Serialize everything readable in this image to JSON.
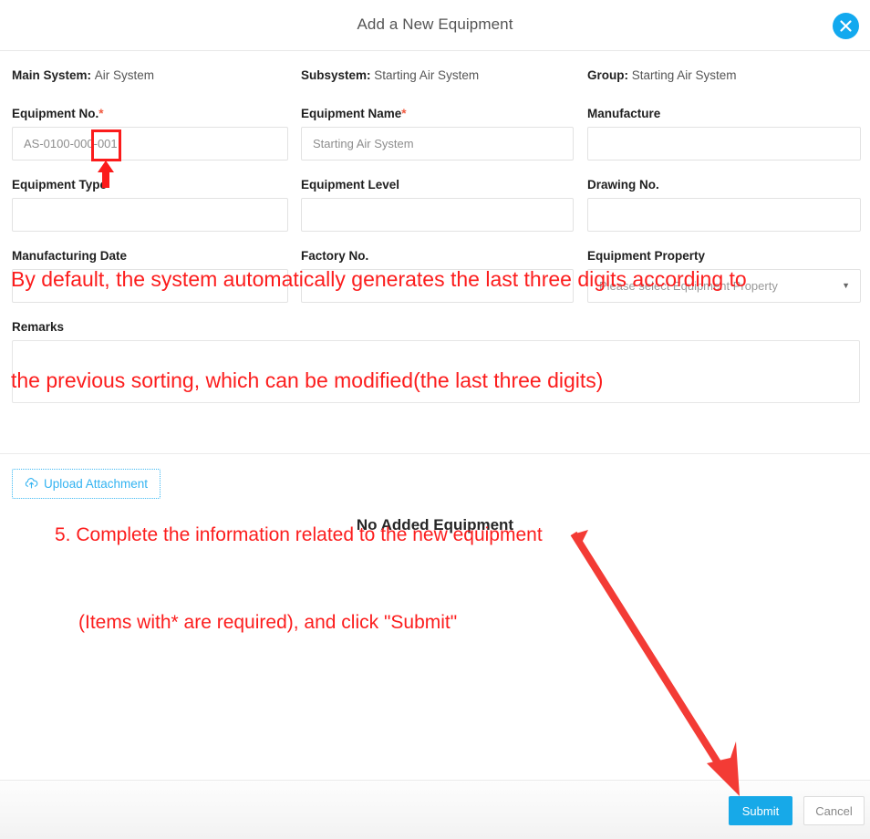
{
  "dialog": {
    "title": "Add a New Equipment",
    "close_icon": "close-icon"
  },
  "context": {
    "main_system_label": "Main System",
    "main_system_value": "Air System",
    "subsystem_label": "Subsystem",
    "subsystem_value": "Starting Air System",
    "group_label": "Group",
    "group_value": "Starting Air System"
  },
  "fields": {
    "equipment_no": {
      "label": "Equipment No.",
      "required": "*",
      "value": "AS-0100-000-001"
    },
    "equipment_name": {
      "label": "Equipment Name",
      "required": "*",
      "value": "Starting Air System"
    },
    "manufacture": {
      "label": "Manufacture",
      "value": ""
    },
    "equipment_type": {
      "label": "Equipment Type",
      "value": ""
    },
    "equipment_level": {
      "label": "Equipment Level",
      "value": ""
    },
    "drawing_no": {
      "label": "Drawing No.",
      "value": ""
    },
    "manufacturing_date": {
      "label": "Manufacturing Date",
      "value": ""
    },
    "factory_no": {
      "label": "Factory No.",
      "value": ""
    },
    "equipment_property": {
      "label": "Equipment Property",
      "placeholder": "Please select Equipment Property",
      "caret": "▼"
    },
    "remarks": {
      "label": "Remarks",
      "value": ""
    }
  },
  "upload": {
    "label": "Upload Attachment",
    "icon": "cloud-upload-icon"
  },
  "empty_state": {
    "text": "No Added Equipment"
  },
  "footer": {
    "submit_label": "Submit",
    "cancel_label": "Cancel"
  },
  "annotations": {
    "note_top_line1": "By default, the system automatically generates the last three digits according to",
    "note_top_line2": "the previous sorting, which can be modified(the last three digits)",
    "note_bottom_line1": "5. Complete the information related to the new equipment",
    "note_bottom_line2": "(Items with* are required), and click \"Submit\"",
    "highlight_target": "001"
  },
  "colors": {
    "accent": "#17a9e8",
    "annotation_red": "#fc1d1d",
    "required_star": "#f05a40",
    "link_blue": "#33b3f1"
  }
}
